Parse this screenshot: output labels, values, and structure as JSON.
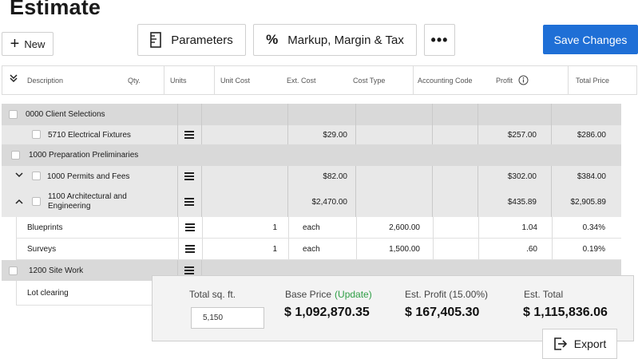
{
  "page": {
    "title": "Estimate"
  },
  "toolbar": {
    "new_label": "New",
    "parameters_label": "Parameters",
    "markup_label": "Markup, Margin & Tax",
    "more_label": "•••",
    "save_label": "Save Changes"
  },
  "table": {
    "headers": {
      "description": "Description",
      "qty": "Qty.",
      "units": "Units",
      "unit_cost": "Unit Cost",
      "ext_cost": "Ext. Cost",
      "cost_type": "Cost Type",
      "accounting_code": "Accounting Code",
      "profit": "Profit",
      "total_price": "Total Price"
    },
    "rows": [
      {
        "desc": "0000 Client Selections"
      },
      {
        "desc": "5710 Electrical Fixtures",
        "ext_cost": "$29.00",
        "profit": "$257.00",
        "total": "$286.00"
      },
      {
        "desc": "1000 Preparation Preliminaries"
      },
      {
        "desc": "1000 Permits and Fees",
        "ext_cost": "$82.00",
        "profit": "$302.00",
        "total": "$384.00"
      },
      {
        "desc": "1100 Architectural and Engineering",
        "ext_cost": "$2,470.00",
        "profit": "$435.89",
        "total": "$2,905.89"
      },
      {
        "desc": "Blueprints",
        "qty": "1",
        "units": "each",
        "unit_cost": "2,600.00",
        "profit": "1.04",
        "total": "0.34%"
      },
      {
        "desc": "Surveys",
        "qty": "1",
        "units": "each",
        "unit_cost": "1,500.00",
        "profit": ".60",
        "total": "0.19%"
      },
      {
        "desc": "1200 Site Work"
      },
      {
        "desc": "Lot clearing"
      }
    ]
  },
  "summary": {
    "sqft_label": "Total sq. ft.",
    "sqft_value": "5,150",
    "base_price_label": "Base Price",
    "update_label": "(Update)",
    "base_price_value": "$ 1,092,870.35",
    "est_profit_label": "Est. Profit (15.00%)",
    "est_profit_value": "$ 167,405.30",
    "est_total_label": "Est. Total",
    "est_total_value": "$ 1,115,836.06",
    "export_label": "Export"
  }
}
